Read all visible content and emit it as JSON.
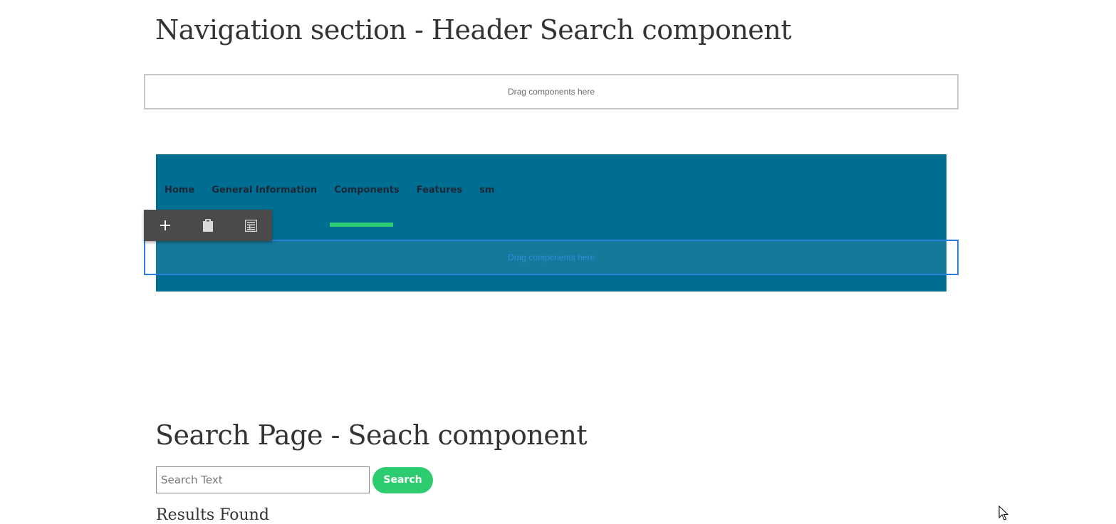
{
  "sections": {
    "navigation_heading": "Navigation section - Header Search component",
    "search_heading": "Search Page - Seach component"
  },
  "dropzones": {
    "top_label": "Drag components here",
    "nav_label": "Drag components here"
  },
  "nav": {
    "items": [
      {
        "label": "Home"
      },
      {
        "label": "General Information"
      },
      {
        "label": "Components",
        "active": true
      },
      {
        "label": "Features"
      },
      {
        "label": "sm"
      }
    ]
  },
  "toolbar": {
    "icons": [
      "plus-icon",
      "clipboard-icon",
      "form-icon"
    ]
  },
  "search": {
    "placeholder": "Search Text",
    "value": "",
    "button_label": "Search",
    "results_label": "Results Found"
  },
  "colors": {
    "nav_background": "#006e92",
    "accent_green": "#2ecc71",
    "selection_blue": "#2b7fd6",
    "toolbar_background": "#4a4a4a"
  }
}
